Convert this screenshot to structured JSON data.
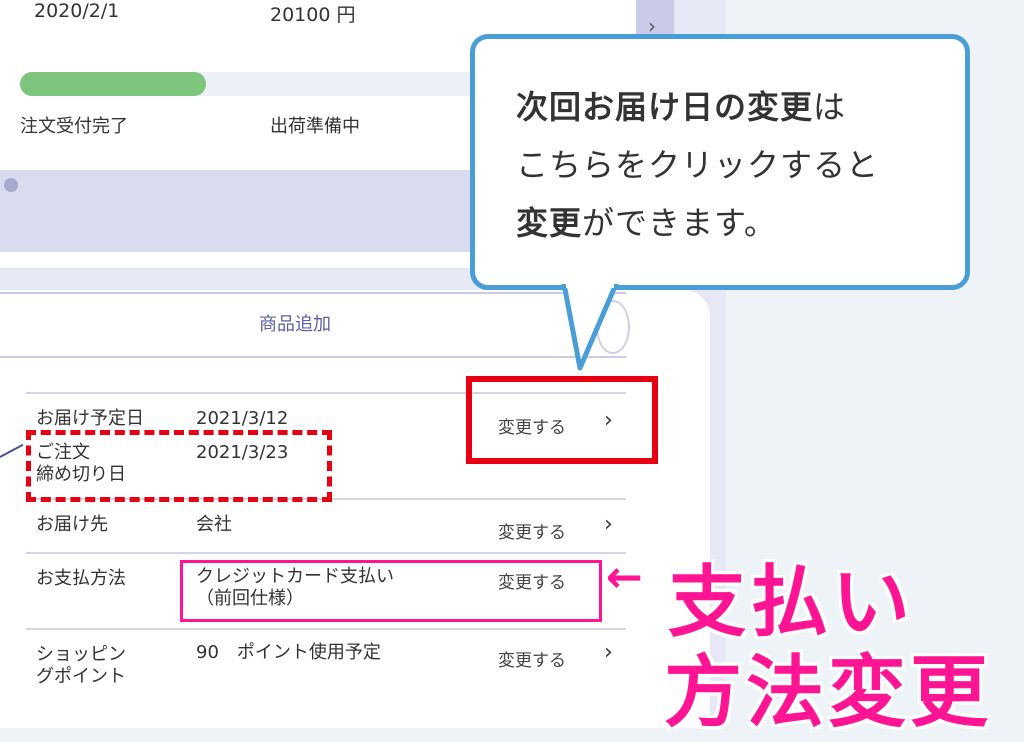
{
  "order": {
    "date": "2020/2/1",
    "amount": "20100 円"
  },
  "progress": {
    "fraction": 0.31,
    "steps": [
      "注文受付完了",
      "出荷準備中"
    ]
  },
  "add_product_label": "商品追加",
  "rows": {
    "delivery_date_label": "お届け予定日",
    "delivery_date_value": "2021/3/12",
    "deadline_label_line1": "ご注文",
    "deadline_label_line2": "締め切り日",
    "deadline_value": "2021/3/23",
    "destination_label": "お届け先",
    "destination_value": "会社",
    "payment_label": "お支払方法",
    "payment_value_line1": "クレジットカード支払い",
    "payment_value_line2": "（前回仕様）",
    "points_label_line1": "ショッピン",
    "points_label_line2": "グポイント",
    "points_value": "90　ポイント使用予定",
    "change_label": "変更する"
  },
  "callout": {
    "line1_bold": "次回お届け日の変更",
    "line1_rest": "は",
    "line2": "こちらをクリックすると",
    "line3_bold": "変更",
    "line3_rest": "ができます。"
  },
  "annotation": {
    "arrow": "←",
    "line1": "支払い",
    "line2": "方法変更"
  },
  "colors": {
    "progress": "#7dc47d",
    "callout_border": "#4a9ed8",
    "highlight_red": "#e60012",
    "highlight_pink": "#ff1493",
    "link_purple": "#5a5fa8"
  },
  "icons": {
    "chevron": "chevron-right-icon"
  }
}
